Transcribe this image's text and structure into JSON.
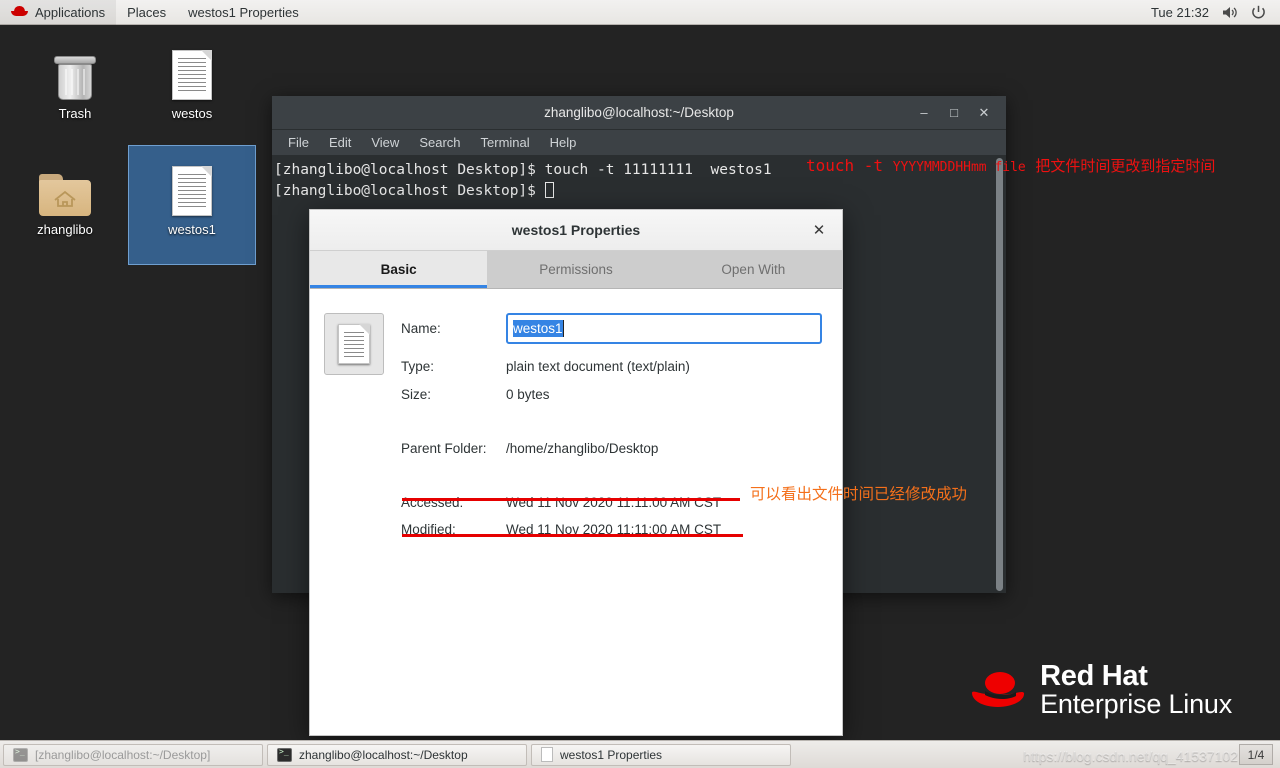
{
  "top_panel": {
    "activities_label": "Applications",
    "places_label": "Places",
    "window_title": "westos1 Properties",
    "clock": "Tue 21:32",
    "volume_icon": "speaker-icon",
    "power_icon": "power-icon"
  },
  "desktop": {
    "icons": [
      {
        "name": "Trash",
        "icon": "trash-icon",
        "selected": false
      },
      {
        "name": "westos",
        "icon": "text-document-icon",
        "selected": false
      },
      {
        "name": "zhanglibo",
        "icon": "home-folder-icon",
        "selected": false
      },
      {
        "name": "westos1",
        "icon": "text-document-icon",
        "selected": true
      }
    ],
    "brand": {
      "line1": "Red Hat",
      "line2": "Enterprise Linux"
    }
  },
  "terminal": {
    "title": "zhanglibo@localhost:~/Desktop",
    "menu": [
      "File",
      "Edit",
      "View",
      "Search",
      "Terminal",
      "Help"
    ],
    "minimize_label": "–",
    "maximize_label": "□",
    "close_label": "✕",
    "lines": [
      {
        "prompt": "[zhanglibo@localhost Desktop]$ ",
        "command": "touch -t 11111111  westos1"
      },
      {
        "prompt": "[zhanglibo@localhost Desktop]$ ",
        "command": ""
      }
    ]
  },
  "annotations": {
    "command_syntax_mono": "touch -t ",
    "command_syntax_small": "YYYYMMDDHHmm file",
    "command_syntax_cn": "把文件时间更改到指定时间",
    "result_cn": "可以看出文件时间已经修改成功",
    "underline_color": "#e60000",
    "result_color": "#f4701b"
  },
  "properties_dialog": {
    "title": "westos1 Properties",
    "close_label": "✕",
    "tabs": [
      {
        "label": "Basic",
        "active": true
      },
      {
        "label": "Permissions",
        "active": false
      },
      {
        "label": "Open With",
        "active": false
      }
    ],
    "file_icon": "text-document-icon",
    "fields": {
      "name_label": "Name:",
      "name_value": "westos1",
      "type_label": "Type:",
      "type_value": "plain text document (text/plain)",
      "size_label": "Size:",
      "size_value": "0 bytes",
      "parent_label": "Parent Folder:",
      "parent_value": "/home/zhanglibo/Desktop",
      "accessed_label": "Accessed:",
      "accessed_value": "Wed 11 Nov 2020 11:11:00 AM CST",
      "modified_label": "Modified:",
      "modified_value": "Wed 11 Nov 2020 11:11:00 AM CST"
    },
    "accent_color": "#3584e4"
  },
  "taskbar": {
    "items": [
      {
        "label": "[zhanglibo@localhost:~/Desktop]",
        "icon": "terminal-icon",
        "minimized": true
      },
      {
        "label": "zhanglibo@localhost:~/Desktop",
        "icon": "terminal-icon",
        "minimized": false
      },
      {
        "label": "westos1 Properties",
        "icon": "text-document-icon",
        "minimized": false
      }
    ],
    "workspace_indicator": "1/4"
  },
  "watermark": "https://blog.csdn.net/qq_41537102"
}
